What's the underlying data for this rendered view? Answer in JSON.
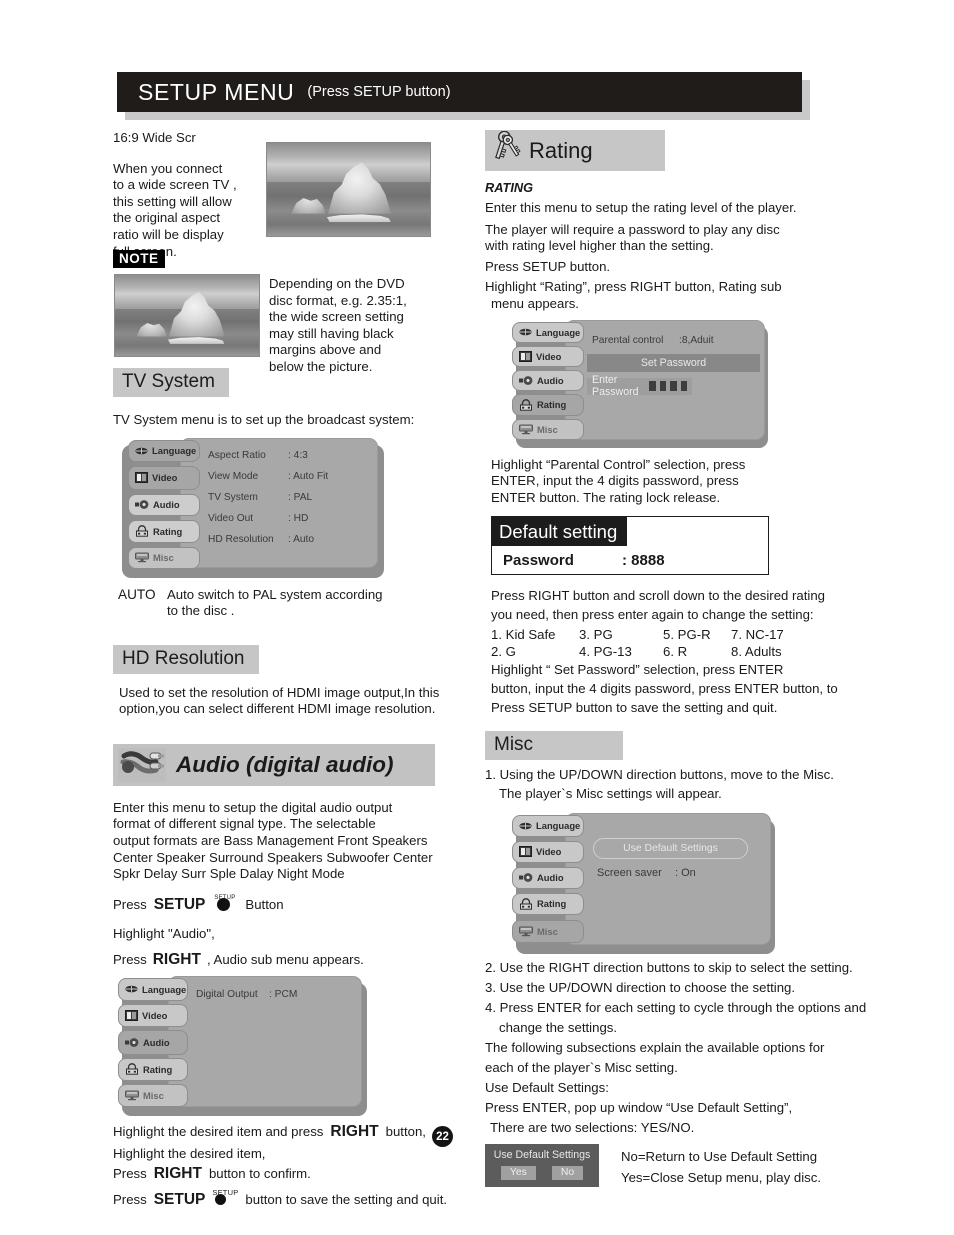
{
  "title_bar": {
    "main": "SETUP MENU",
    "sub": "(Press SETUP button)"
  },
  "page_number": "22",
  "left_column": {
    "wide_scr_heading": "16:9 Wide Scr",
    "wide_scr_body": "When you connect\nto a wide  screen TV ,\nthis setting will  allow\nthe original aspect\nratio will be display\nfull screen.",
    "note_badge": "NOTE",
    "note_body": "Depending on the  DVD\ndisc format, e.g.  2.35:1,\nthe wide screen setting\nmay still having  black\nmargins above and\nbelow the picture.",
    "tv_system": {
      "header": "TV System",
      "intro": "TV System menu  is to set up the broadcast  system:",
      "menu": {
        "tabs": [
          "Language",
          "Video",
          "Audio",
          "Rating",
          "Misc"
        ],
        "selected_tab": "Video",
        "rows": [
          {
            "label": "Aspect Ratio",
            "value": ":  4:3"
          },
          {
            "label": "View Mode",
            "value": ": Auto Fit"
          },
          {
            "label": "TV System",
            "value": ": PAL"
          },
          {
            "label": "Video Out",
            "value": ": HD"
          },
          {
            "label": "HD Resolution",
            "value": ": Auto"
          }
        ]
      },
      "auto_key": "AUTO",
      "auto_desc": "Auto switch to PAL  system according\nto the disc ."
    },
    "hd_resolution": {
      "header": "HD Resolution",
      "body": "Used to set the resolution of HDMI image output,In this\noption,you can select different HDMI image resolution."
    },
    "audio": {
      "header": "Audio (digital   audio)",
      "body_lines": [
        "Enter this menu   to setup the  digital audio output",
        "format of different signal type. The selectable",
        "output formats are Bass Management    Front Speakers",
        "Center Speaker   Surround Speakers   Subwoofer   Center",
        "Spkr Delay    Surr Sple Dalay    Night Mode"
      ],
      "press_setup_pre": "Press",
      "press_setup_bold": "SETUP",
      "press_setup_post": "Button",
      "setup_cap": "SETUP",
      "highlight_audio": "Highlight \"Audio\",",
      "press_right_pre": "Press",
      "press_right_bold": "RIGHT",
      "press_right_post": ", Audio sub menu appears.",
      "menu": {
        "tabs": [
          "Language",
          "Video",
          "Audio",
          "Rating",
          "Misc"
        ],
        "selected_tab": "Audio",
        "rows": [
          {
            "label": "Digital Output",
            "value": ": PCM"
          }
        ]
      },
      "footer_lines": [
        {
          "a": "Highlight the desired   item and press",
          "b": "RIGHT",
          "c": "button,"
        },
        {
          "a": "Highlight the desired   item,",
          "b": "",
          "c": ""
        },
        {
          "a": "Press",
          "b": "RIGHT",
          "c": "button to confirm."
        },
        {
          "a": "Press",
          "b": "SETUP",
          "c": "button to save  the setting and quit."
        }
      ]
    }
  },
  "right_column": {
    "rating": {
      "header": "Rating",
      "subheader": "RATING",
      "body_lines": [
        "Enter this menu to setup the rating level of the player.",
        "The player will require a  password to play any disc",
        "with rating level higher than the setting.",
        "Press SETUP button.",
        "Highlight “Rating”, press RIGHT  button, Rating sub",
        "menu appears."
      ],
      "menu": {
        "tabs": [
          "Language",
          "Video",
          "Audio",
          "Rating",
          "Misc"
        ],
        "selected_tab": "Rating",
        "parental_label": "Parental control",
        "parental_value": ":8,Aduit",
        "set_password_btn": "Set Password",
        "enter_password_label": "Enter Password",
        "password_digits": 4
      },
      "after_menu_lines": [
        "Highlight “Parental Control” selection, press",
        "ENTER, input the 4 digits password, press",
        "ENTER button.  The rating lock release."
      ],
      "default_setting": {
        "title": "Default setting",
        "key": "Password",
        "value": ": 8888"
      },
      "scroll_lines": [
        "Press RIGHT button and scroll down to the desired rating",
        "you need, then press enter again to change the setting:"
      ],
      "rating_levels": [
        "1. Kid Safe",
        "3. PG",
        "5. PG-R",
        "7. NC-17",
        "2. G",
        "4. PG-13",
        "6. R",
        "8. Adults"
      ],
      "tail_lines": [
        "Highlight “ Set Password” selection, press ENTER",
        "button, input the 4 digits password, press ENTER button, to",
        "Press SETUP button to save the setting and quit."
      ]
    },
    "misc": {
      "header": "Misc",
      "step1": "1. Using the UP/DOWN direction buttons, move to the Misc.",
      "step1b": "The player`s Misc settings will appear.",
      "menu": {
        "tabs": [
          "Language",
          "Video",
          "Audio",
          "Rating",
          "Misc"
        ],
        "selected_tab": "Misc",
        "default_btn": "Use Default Settings",
        "screen_saver_label": "Screen saver",
        "screen_saver_value": ": On"
      },
      "steps": [
        "2. Use the RIGHT direction buttons to skip to select the setting.",
        "3. Use the UP/DOWN direction to choose the setting.",
        "4. Press ENTER for each setting to cycle through the options and",
        "change the settings."
      ],
      "body_lines": [
        "The following subsections explain the available options for",
        "each of the player`s Misc setting.",
        "Use Default Settings:",
        "Press ENTER, pop up window “Use Default Setting”,",
        "There are two selections: YES/NO."
      ],
      "popup": {
        "title": "Use Default Settings",
        "yes": "Yes",
        "no": "No"
      },
      "popup_desc": [
        "No=Return to Use Default Setting",
        "Yes=Close Setup menu, play disc."
      ]
    }
  },
  "colors": {
    "title_bg": "#201c1a",
    "band_gray": "#c6c6c6",
    "osd_panel": "#a8a8a8",
    "osd_tab": "#cdcdcd"
  }
}
